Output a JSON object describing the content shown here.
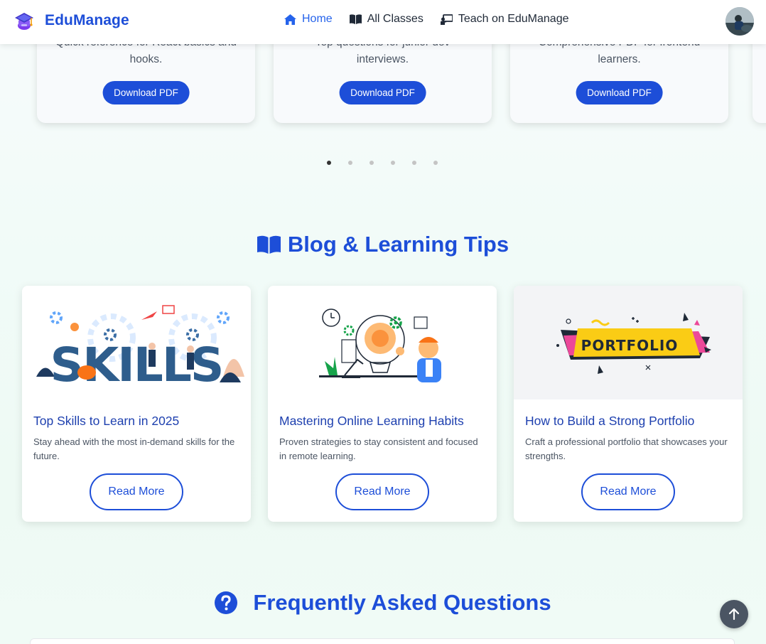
{
  "navbar": {
    "brand": "EduManage",
    "links": [
      {
        "label": "Home",
        "icon": "home-icon",
        "active": true
      },
      {
        "label": "All Classes",
        "icon": "book-icon",
        "active": false
      },
      {
        "label": "Teach on EduManage",
        "icon": "teacher-icon",
        "active": false
      }
    ],
    "avatar": "user-avatar"
  },
  "pdf_cards": [
    {
      "description": "Quick reference for React basics and hooks.",
      "button": "Download PDF"
    },
    {
      "description": "Top questions for junior dev interviews.",
      "button": "Download PDF"
    },
    {
      "description": "Comprehensive PDF for frontend learners.",
      "button": "Download PDF"
    }
  ],
  "carousel": {
    "dots": 6,
    "active_index": 0
  },
  "blog": {
    "title": "Blog & Learning Tips",
    "cards": [
      {
        "title": "Top Skills to Learn in 2025",
        "description": "Stay ahead with the most in-demand skills for the future.",
        "button": "Read More",
        "image_text": "SKILLS"
      },
      {
        "title": "Mastering Online Learning Habits",
        "description": "Proven strategies to stay consistent and focused in remote learning.",
        "button": "Read More"
      },
      {
        "title": "How to Build a Strong Portfolio",
        "description": "Craft a professional portfolio that showcases your strengths.",
        "button": "Read More",
        "image_text": "PORTFOLIO"
      }
    ]
  },
  "faq": {
    "title": "Frequently Asked Questions"
  },
  "colors": {
    "primary": "#1d4ed8",
    "active_link": "#2563eb",
    "accent_yellow": "#facc15",
    "accent_pink": "#ec4899"
  }
}
